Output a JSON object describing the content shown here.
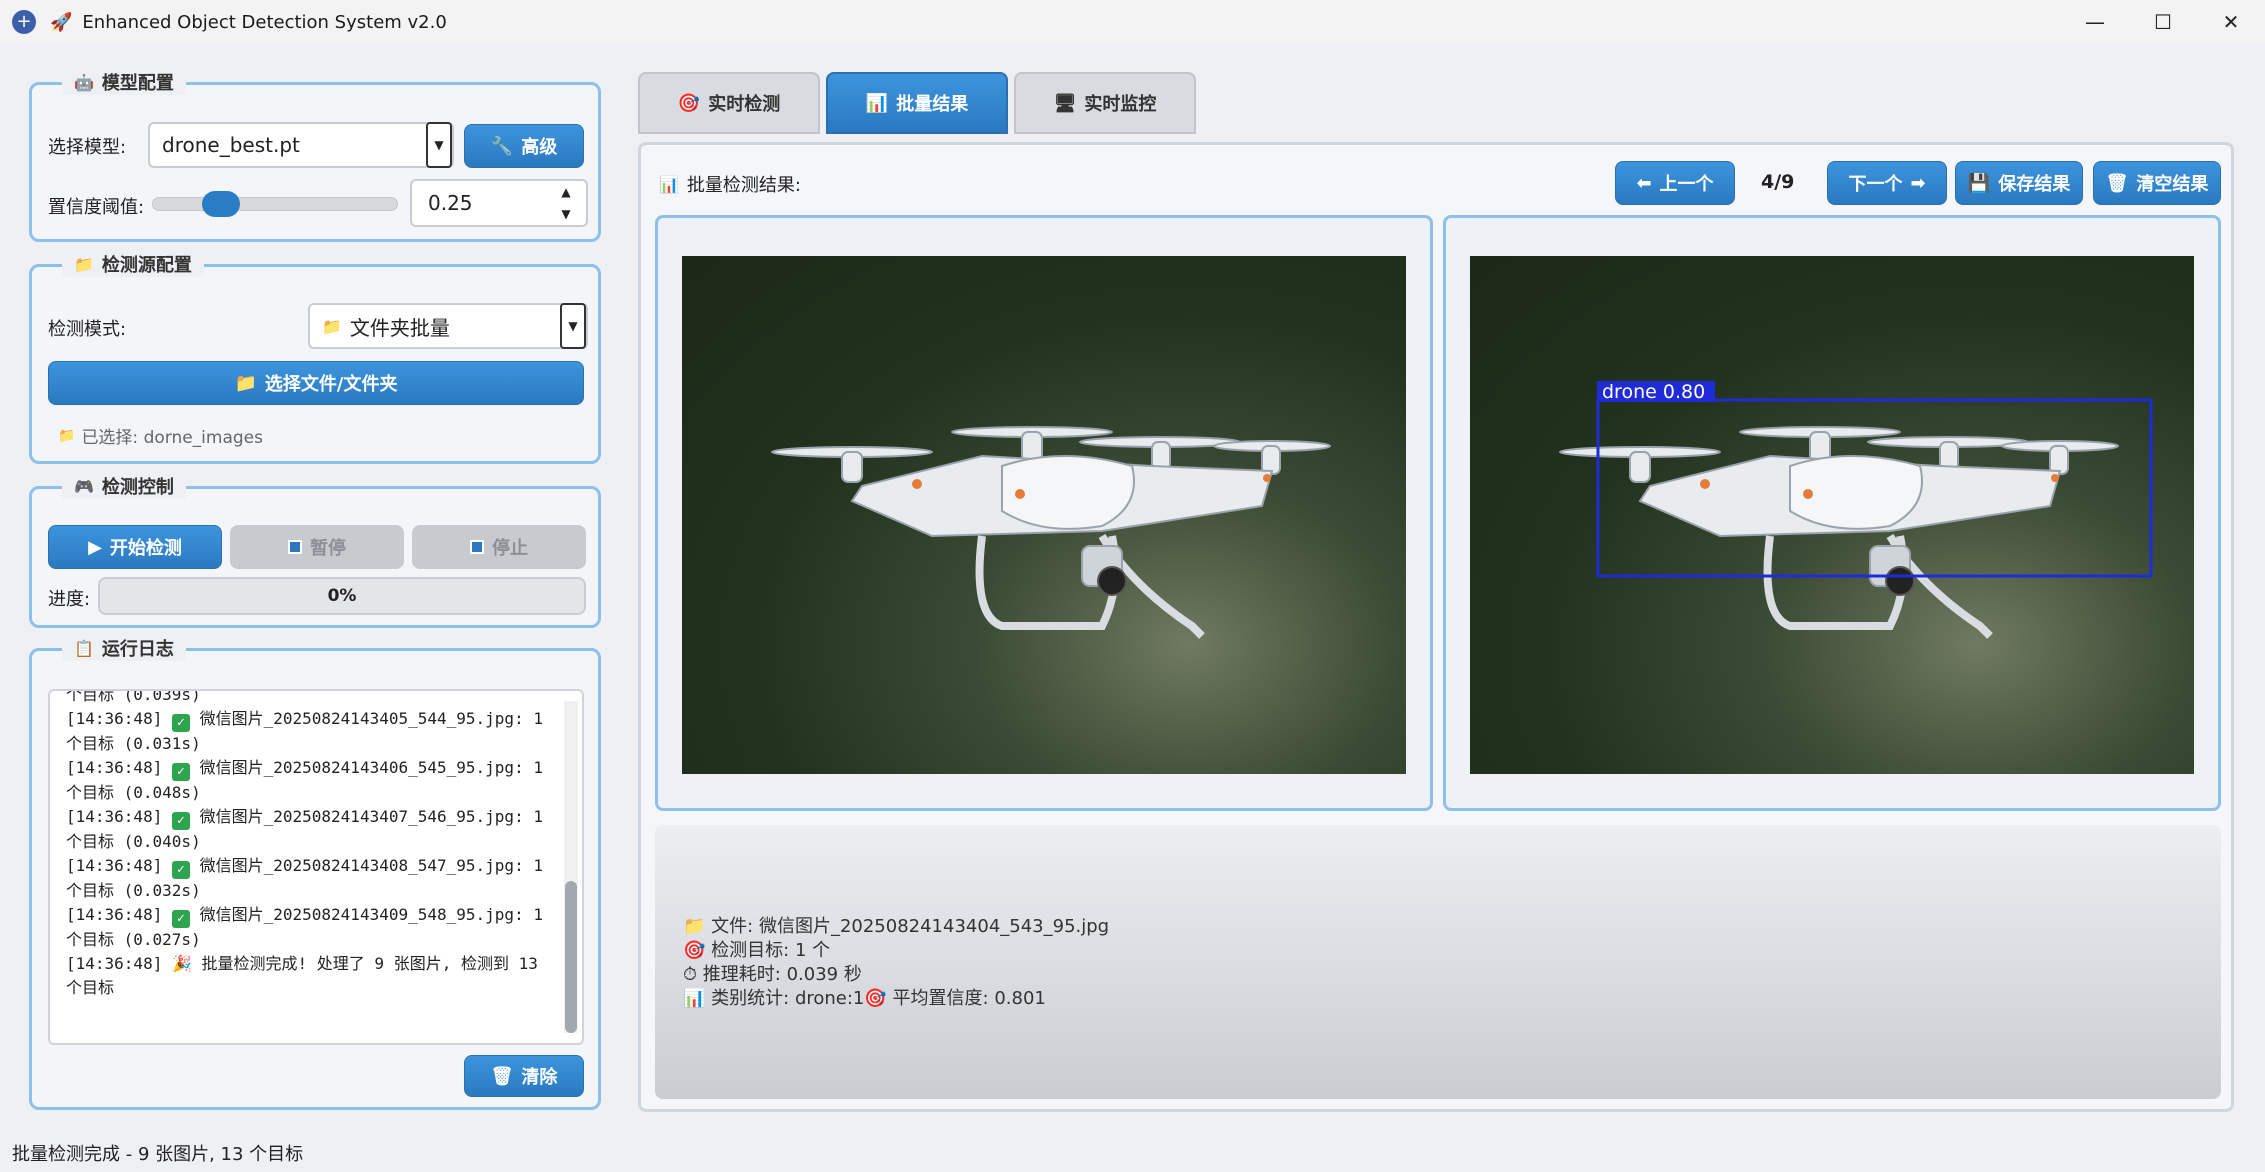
{
  "window": {
    "title": "Enhanced Object Detection System v2.0",
    "title_emoji": "🚀",
    "controls": [
      "—",
      "☐",
      "✕"
    ]
  },
  "model_config": {
    "title": "模型配置",
    "icon": "robot-icon",
    "model_label": "选择模型:",
    "model_value": "drone_best.pt",
    "advanced_button": "高级",
    "confidence_label": "置信度阈值:",
    "confidence_value": "0.25",
    "confidence_fraction": 0.25
  },
  "source_config": {
    "title": "检测源配置",
    "mode_label": "检测模式:",
    "mode_value": "文件夹批量",
    "select_button": "选择文件/文件夹",
    "selected_text": "已选择: dorne_images"
  },
  "detect_control": {
    "title": "检测控制",
    "start_button": "开始检测",
    "pause_button": "暂停",
    "stop_button": "停止",
    "progress_label": "进度:",
    "progress_text": "0%",
    "progress_value": 0
  },
  "log": {
    "title": "运行日志",
    "lines": [
      {
        "time": "",
        "check": false,
        "text": "个目标 (0.039s)"
      },
      {
        "time": "[14:36:48]",
        "check": true,
        "text": "微信图片_20250824143405_544_95.jpg: 1 个目标 (0.031s)"
      },
      {
        "time": "[14:36:48]",
        "check": true,
        "text": "微信图片_20250824143406_545_95.jpg: 1 个目标 (0.048s)"
      },
      {
        "time": "[14:36:48]",
        "check": true,
        "text": "微信图片_20250824143407_546_95.jpg: 1 个目标 (0.040s)"
      },
      {
        "time": "[14:36:48]",
        "check": true,
        "text": "微信图片_20250824143408_547_95.jpg: 1 个目标 (0.032s)"
      },
      {
        "time": "[14:36:48]",
        "check": true,
        "text": "微信图片_20250824143409_548_95.jpg: 1 个目标 (0.027s)"
      },
      {
        "time": "[14:36:48]",
        "check": false,
        "text": "🎉 批量检测完成! 处理了 9 张图片, 检测到 13 个目标"
      }
    ],
    "clear_button": "清除"
  },
  "tabs": [
    {
      "label": "实时检测",
      "icon": "target-icon"
    },
    {
      "label": "批量结果",
      "icon": "bar-chart-icon"
    },
    {
      "label": "实时监控",
      "icon": "monitor-icon"
    }
  ],
  "batch": {
    "label": "批量检测结果:",
    "prev_button": "上一个",
    "counter": "4/9",
    "next_button": "下一个",
    "save_button": "保存结果",
    "clear_button": "清空结果",
    "detection_label": "drone  0.80",
    "box_color": "#1f2bd6"
  },
  "info": {
    "file": "文件: 微信图片_20250824143404_543_95.jpg",
    "targets": "检测目标: 1 个",
    "time": "推理耗时: 0.039 秒",
    "stats_a": "类别统计: drone:1",
    "stats_b": "平均置信度: 0.801"
  },
  "status_bar": "批量检测完成 - 9 张图片, 13 个目标"
}
